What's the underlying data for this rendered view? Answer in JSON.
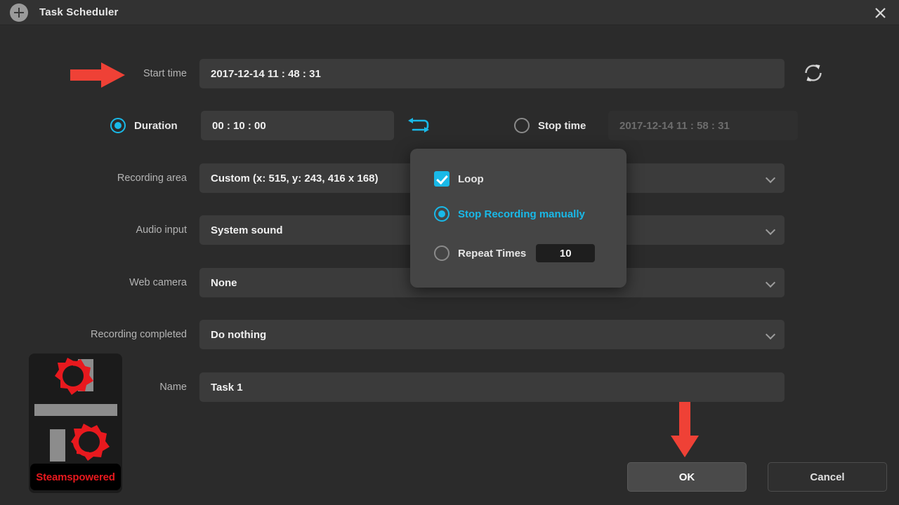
{
  "window": {
    "title": "Task Scheduler",
    "add_icon": "plus-circle-icon",
    "close_icon": "close-icon"
  },
  "colors": {
    "accent": "#19b9e8",
    "annotation": "#ef4136",
    "dialog_bg": "#2b2b2b",
    "titlebar_bg": "#323232",
    "field_bg": "#3b3b3b",
    "popup_bg": "#454545",
    "watermark_red": "#e8191e"
  },
  "form": {
    "start_time": {
      "label": "Start time",
      "value": "2017-12-14 11 : 48 : 31",
      "refresh_icon": "refresh-icon"
    },
    "duration": {
      "label": "Duration",
      "value": "00 : 10 : 00",
      "selected": true,
      "loop_icon": "loop-icon"
    },
    "stop_time": {
      "label": "Stop time",
      "value": "2017-12-14 11 : 58 : 31",
      "selected": false
    },
    "recording_area": {
      "label": "Recording area",
      "value": "Custom (x: 515, y: 243, 416 x 168)"
    },
    "audio_input": {
      "label": "Audio input",
      "value": "System sound"
    },
    "web_camera": {
      "label": "Web camera",
      "value": "None"
    },
    "recording_completed": {
      "label": "Recording completed",
      "value": "Do nothing"
    },
    "name": {
      "label": "Name",
      "value": "Task 1"
    }
  },
  "popup": {
    "loop": {
      "label": "Loop",
      "checked": true
    },
    "stop_manually": {
      "label": "Stop Recording manually",
      "selected": true
    },
    "repeat_times": {
      "label": "Repeat Times",
      "value": "10",
      "selected": false
    }
  },
  "buttons": {
    "ok": "OK",
    "cancel": "Cancel"
  },
  "annotations": {
    "start_time_arrow": "arrow-right-icon",
    "ok_button_arrow": "arrow-down-icon"
  },
  "watermark": {
    "text": "Steamspowered",
    "logo": "gear-logo-icon"
  }
}
